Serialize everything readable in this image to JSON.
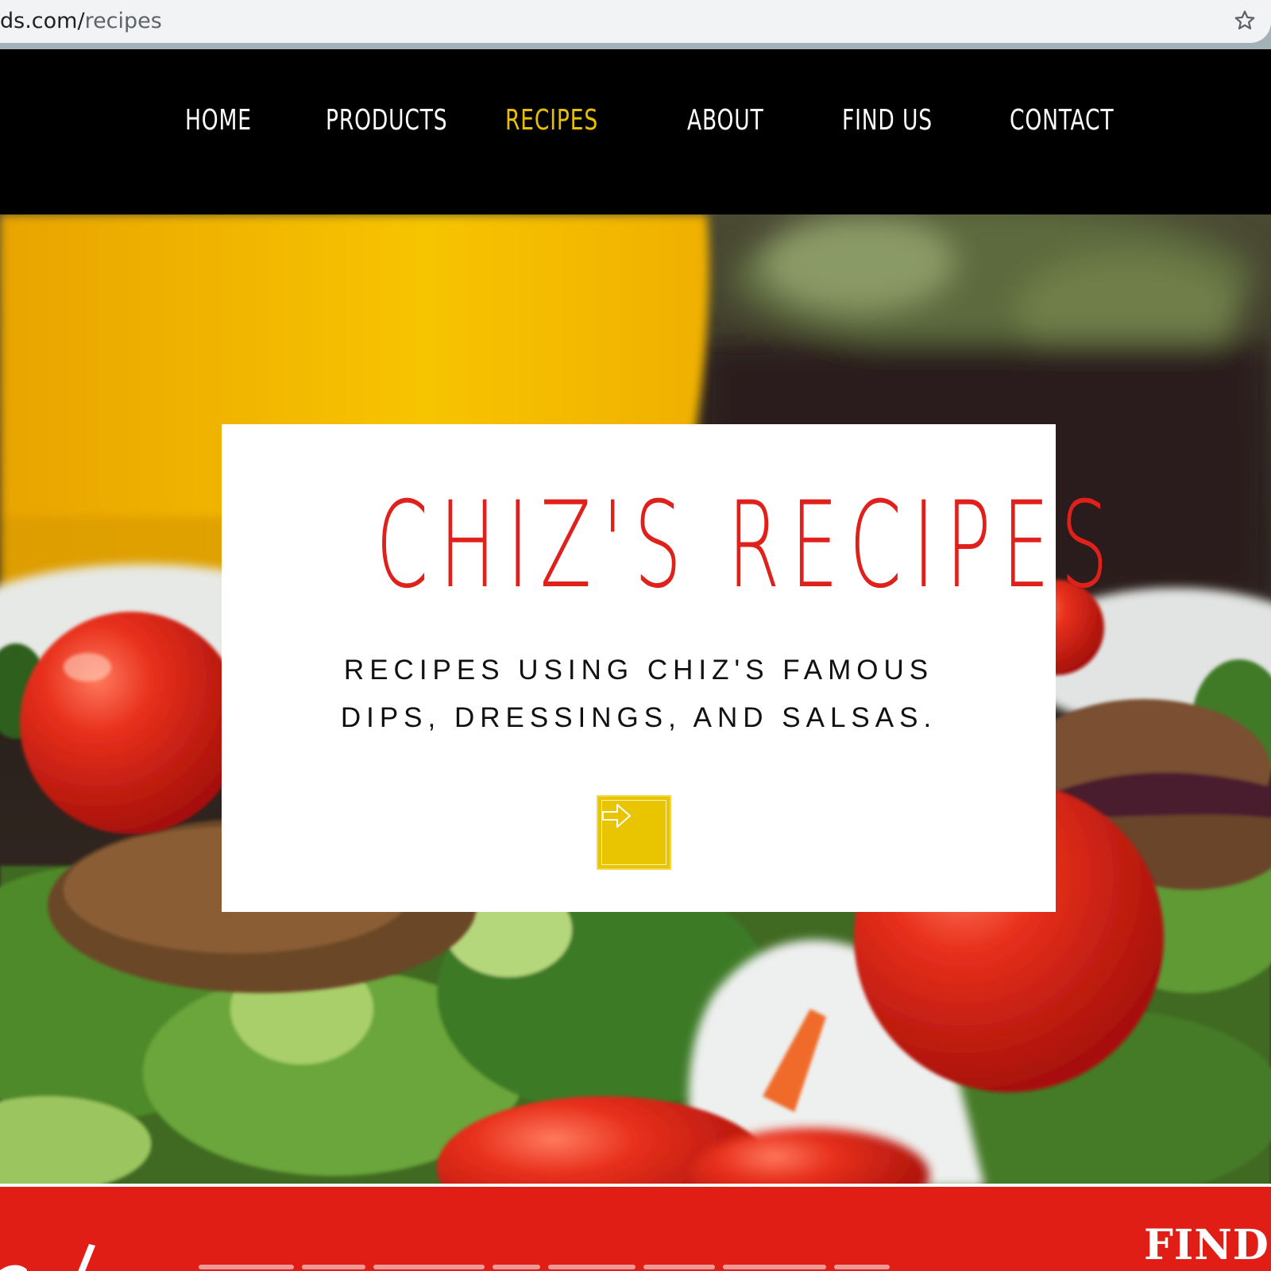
{
  "browser": {
    "url_domain": "ds.com/",
    "url_path": "recipes"
  },
  "nav": {
    "items": [
      {
        "label": "HOME",
        "active": false
      },
      {
        "label": "PRODUCTS",
        "active": false
      },
      {
        "label": "RECIPES",
        "active": true
      },
      {
        "label": "ABOUT",
        "active": false
      },
      {
        "label": "FIND US",
        "active": false
      },
      {
        "label": "CONTACT",
        "active": false
      }
    ],
    "active_color": "#e8c000"
  },
  "hero": {
    "title": "CHIZ'S RECIPES",
    "subtitle_line1": "RECIPES USING CHIZ'S FAMOUS",
    "subtitle_line2": "DIPS, DRESSINGS, AND SALSAS.",
    "button_icon": "arrow-right-icon",
    "title_color": "#e0201b",
    "button_color": "#e9c400"
  },
  "footer_band": {
    "heading": "FIND",
    "color": "#e01e16"
  }
}
